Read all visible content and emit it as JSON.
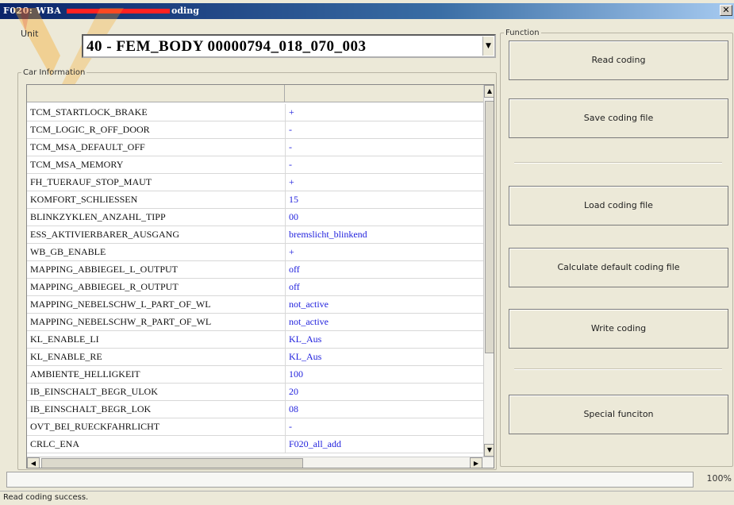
{
  "window": {
    "title": "F020: WBA",
    "title_suffix": "oding",
    "close_glyph": "✕"
  },
  "unit": {
    "label": "Unit",
    "selected_value": "40 - FEM_BODY   00000794_018_070_003",
    "dropdown_glyph": "▼"
  },
  "car_information": {
    "legend": "Car Information",
    "rows": [
      {
        "name": "TCM_STARTLOCK_BRAKE",
        "value": "+"
      },
      {
        "name": "TCM_LOGIC_R_OFF_DOOR",
        "value": "-"
      },
      {
        "name": "TCM_MSA_DEFAULT_OFF",
        "value": "-"
      },
      {
        "name": "TCM_MSA_MEMORY",
        "value": "-"
      },
      {
        "name": "FH_TUERAUF_STOP_MAUT",
        "value": "+"
      },
      {
        "name": "KOMFORT_SCHLIESSEN",
        "value": "15"
      },
      {
        "name": "BLINKZYKLEN_ANZAHL_TIPP",
        "value": "00"
      },
      {
        "name": "ESS_AKTIVIERBARER_AUSGANG",
        "value": "bremslicht_blinkend"
      },
      {
        "name": "WB_GB_ENABLE",
        "value": "+"
      },
      {
        "name": "MAPPING_ABBIEGEL_L_OUTPUT",
        "value": "off"
      },
      {
        "name": "MAPPING_ABBIEGEL_R_OUTPUT",
        "value": "off"
      },
      {
        "name": "MAPPING_NEBELSCHW_L_PART_OF_WL",
        "value": "not_active"
      },
      {
        "name": "MAPPING_NEBELSCHW_R_PART_OF_WL",
        "value": "not_active"
      },
      {
        "name": "KL_ENABLE_LI",
        "value": "KL_Aus"
      },
      {
        "name": "KL_ENABLE_RE",
        "value": "KL_Aus"
      },
      {
        "name": "AMBIENTE_HELLIGKEIT",
        "value": "100"
      },
      {
        "name": "IB_EINSCHALT_BEGR_ULOK",
        "value": "20"
      },
      {
        "name": "IB_EINSCHALT_BEGR_LOK",
        "value": "08"
      },
      {
        "name": "OVT_BEI_RUECKFAHRLICHT",
        "value": "-"
      },
      {
        "name": "CRLC_ENA",
        "value": "F020_all_add"
      }
    ],
    "scroll_up_glyph": "▲",
    "scroll_down_glyph": "▼",
    "scroll_left_glyph": "◀",
    "scroll_right_glyph": "▶"
  },
  "function": {
    "legend": "Function",
    "buttons": {
      "read_coding": "Read coding",
      "save_coding_file": "Save coding file",
      "load_coding_file": "Load coding file",
      "calculate_default": "Calculate default coding file",
      "write_coding": "Write coding",
      "special_function": "Special funciton"
    }
  },
  "progress": {
    "percent_text": "100%",
    "fraction": 1.0
  },
  "status": {
    "message": "Read coding success."
  },
  "colors": {
    "value_text": "#2222dd",
    "title_bar": "#0a246a",
    "redaction": "#ff2222",
    "watermark": "#f5a623"
  }
}
